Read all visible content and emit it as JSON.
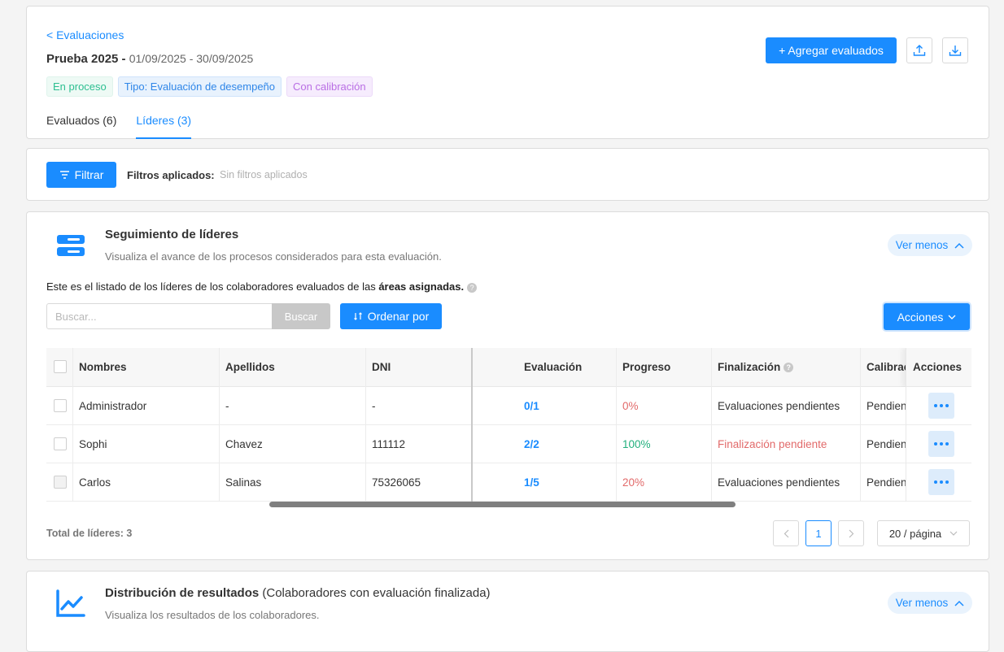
{
  "header": {
    "back_link": "< Evaluaciones",
    "title": "Prueba 2025",
    "separator": " - ",
    "dates": "01/09/2025 - 30/09/2025",
    "tags": [
      "En proceso",
      "Tipo: Evaluación de desempeño",
      "Con calibración"
    ],
    "tabs": [
      "Evaluados (6)",
      "Líderes (3)"
    ],
    "add_button": "+ Agregar evaluados"
  },
  "filter": {
    "button": "Filtrar",
    "label": "Filtros aplicados:",
    "value": "Sin filtros aplicados"
  },
  "leaders": {
    "title": "Seguimiento de líderes",
    "subtitle": "Visualiza el avance de los procesos considerados para esta evaluación.",
    "toggle": "Ver menos",
    "note_prefix": "Este es el listado de los líderes de los colaboradores evaluados de las ",
    "note_bold": "áreas asignadas.",
    "search_placeholder": "Buscar...",
    "search_button": "Buscar",
    "sort_button": "Ordenar por",
    "actions_button": "Acciones",
    "columns": [
      "Nombres",
      "Apellidos",
      "DNI",
      "Evaluación",
      "Progreso",
      "Finalización",
      "Calibración",
      "Acciones"
    ],
    "rows": [
      {
        "nombres": "Administrador",
        "apellidos": "-",
        "dni": "-",
        "evaluacion": "0/1",
        "progreso": "0%",
        "finalizacion": "Evaluaciones pendientes",
        "calibracion": "Pendiente"
      },
      {
        "nombres": "Sophi",
        "apellidos": "Chavez",
        "dni": "111112",
        "evaluacion": "2/2",
        "progreso": "100%",
        "finalizacion": "Finalización pendiente",
        "calibracion": "Pendiente"
      },
      {
        "nombres": "Carlos",
        "apellidos": "Salinas",
        "dni": "75326065",
        "evaluacion": "1/5",
        "progreso": "20%",
        "finalizacion": "Evaluaciones pendientes",
        "calibracion": "Pendiente"
      }
    ],
    "total": "Total de líderes: 3",
    "page": "1",
    "page_size": "20 / página"
  },
  "distribution": {
    "title": "Distribución de resultados",
    "title_extra": " (Colaboradores con evaluación finalizada)",
    "subtitle": "Visualiza los resultados de los colaboradores.",
    "toggle": "Ver menos"
  },
  "colors": {
    "primary": "#1a8cff",
    "success": "#22b07d",
    "danger": "#e26a6a"
  }
}
